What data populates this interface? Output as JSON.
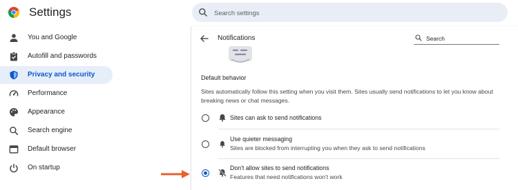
{
  "header": {
    "title": "Settings",
    "logo_icon": "chrome-logo-icon",
    "search_placeholder": "Search settings"
  },
  "sidebar": {
    "items": [
      {
        "label": "You and Google",
        "icon": "person-icon"
      },
      {
        "label": "Autofill and passwords",
        "icon": "clipboard-icon"
      },
      {
        "label": "Privacy and security",
        "icon": "shield-icon",
        "active": true
      },
      {
        "label": "Performance",
        "icon": "speedometer-icon"
      },
      {
        "label": "Appearance",
        "icon": "palette-icon"
      },
      {
        "label": "Search engine",
        "icon": "search-icon"
      },
      {
        "label": "Default browser",
        "icon": "browser-window-icon"
      },
      {
        "label": "On startup",
        "icon": "power-icon"
      }
    ]
  },
  "panel": {
    "title": "Notifications",
    "search_placeholder": "Search",
    "section_title": "Default behavior",
    "description": "Sites automatically follow this setting when you visit them. Sites usually send notifications to let you know about breaking news or chat messages.",
    "options": [
      {
        "label": "Sites can ask to send notifications",
        "sublabel": "",
        "icon": "bell-icon",
        "checked": false
      },
      {
        "label": "Use quieter messaging",
        "sublabel": "Sites are blocked from interrupting you when they ask to send notifications",
        "icon": "bell-quiet-icon",
        "checked": false
      },
      {
        "label": "Don't allow sites to send notifications",
        "sublabel": "Features that need notifications won't work",
        "icon": "bell-off-icon",
        "checked": true
      }
    ]
  },
  "colors": {
    "accent": "#0b57d0",
    "active_nav_bg": "#e6eef9",
    "search_bg": "#e9eef6",
    "annotation_arrow": "#e8602c"
  }
}
